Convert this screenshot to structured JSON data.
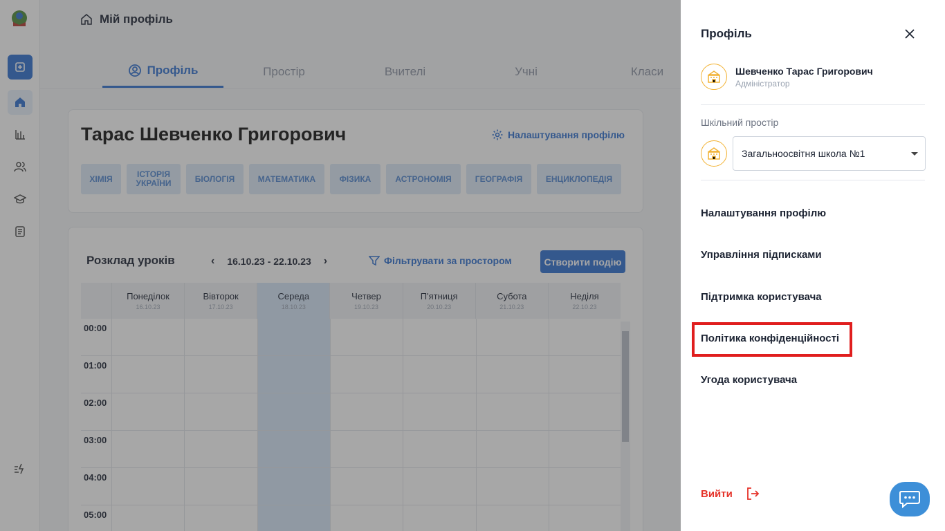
{
  "breadcrumb": {
    "title": "Мій профіль"
  },
  "tabs": [
    {
      "label": "Профіль",
      "active": true
    },
    {
      "label": "Простір"
    },
    {
      "label": "Вчителі"
    },
    {
      "label": "Учні"
    },
    {
      "label": "Класи"
    }
  ],
  "profile": {
    "name": "Тарас Шевченко Григорович",
    "settings_label": "Налаштування профілю",
    "subjects": [
      "ХІМІЯ",
      "ІСТОРІЯ УКРАЇНИ",
      "БІОЛОГІЯ",
      "МАТЕМАТИКА",
      "ФІЗИКА",
      "АСТРОНОМІЯ",
      "ГЕОГРАФІЯ",
      "ЕНЦИКЛОПЕДІЯ"
    ]
  },
  "schedule": {
    "title": "Розклад уроків",
    "range": "16.10.23 - 22.10.23",
    "filter_label": "Фільтрувати за простором",
    "create_label": "Створити подію",
    "days": [
      {
        "name": "Понеділок",
        "date": "16.10.23"
      },
      {
        "name": "Вівторок",
        "date": "17.10.23"
      },
      {
        "name": "Середа",
        "date": "18.10.23",
        "today": true
      },
      {
        "name": "Четвер",
        "date": "19.10.23"
      },
      {
        "name": "П'ятниця",
        "date": "20.10.23"
      },
      {
        "name": "Субота",
        "date": "21.10.23"
      },
      {
        "name": "Неділя",
        "date": "22.10.23"
      }
    ],
    "hours": [
      "00:00",
      "01:00",
      "02:00",
      "03:00",
      "04:00",
      "05:00"
    ]
  },
  "drawer": {
    "title": "Профіль",
    "user_name": "Шевченко Тарас Григорович",
    "user_role": "Адміністратор",
    "space_label": "Шкільний простір",
    "space_value": "Загальноосвітня школа №1",
    "menu": [
      "Налаштування профілю",
      "Управління підписками",
      "Підтримка користувача",
      "Політика конфіденційності",
      "Угода користувача"
    ],
    "logout_label": "Вийти"
  },
  "colors": {
    "accent": "#2f6fd0",
    "danger": "#e5332a",
    "school_icon": "#f2b233",
    "highlight": "#e01e1e"
  }
}
